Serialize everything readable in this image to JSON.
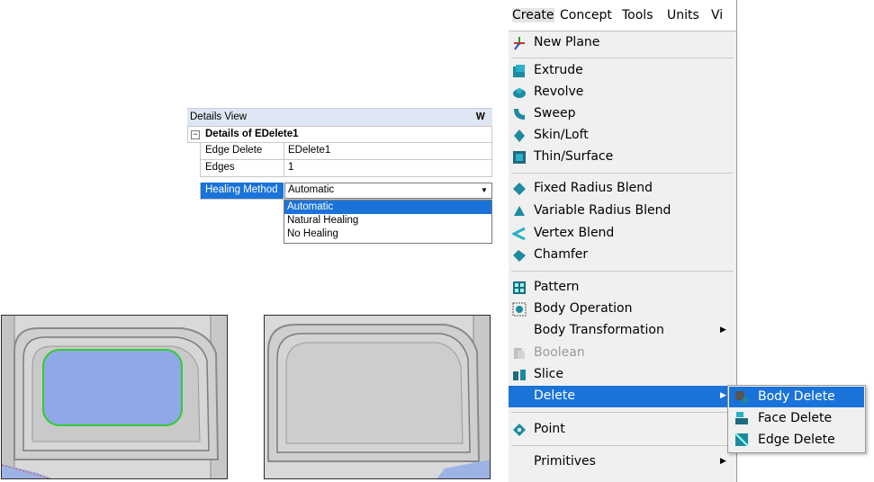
{
  "details_view": {
    "title": "Details View",
    "pin_icon": "pin-icon",
    "group_title": "Details of EDelete1",
    "rows": [
      {
        "key": "Edge Delete",
        "value": "EDelete1"
      },
      {
        "key": "Edges",
        "value": "1"
      }
    ],
    "healing": {
      "key": "Healing Method",
      "value": "Automatic",
      "options": [
        "Automatic",
        "Natural Healing",
        "No Healing"
      ]
    }
  },
  "menubar": {
    "items": [
      "Create",
      "Concept",
      "Tools",
      "Units",
      "Vi"
    ]
  },
  "create_menu": {
    "new_plane": "New Plane",
    "extrude": "Extrude",
    "revolve": "Revolve",
    "sweep": "Sweep",
    "skin_loft": "Skin/Loft",
    "thin_surface": "Thin/Surface",
    "fixed_radius_blend": "Fixed Radius Blend",
    "variable_radius_blend": "Variable Radius Blend",
    "vertex_blend": "Vertex Blend",
    "chamfer": "Chamfer",
    "pattern": "Pattern",
    "body_operation": "Body Operation",
    "body_transformation": "Body Transformation",
    "boolean": "Boolean",
    "slice": "Slice",
    "delete": "Delete",
    "point": "Point",
    "primitives": "Primitives"
  },
  "delete_submenu": {
    "body_delete": "Body Delete",
    "face_delete": "Face Delete",
    "edge_delete": "Edge Delete"
  },
  "colors": {
    "selection_blue": "#1a73d8",
    "selected_face_fill": "#8fa8e8",
    "selected_face_edge": "#33cc33"
  }
}
